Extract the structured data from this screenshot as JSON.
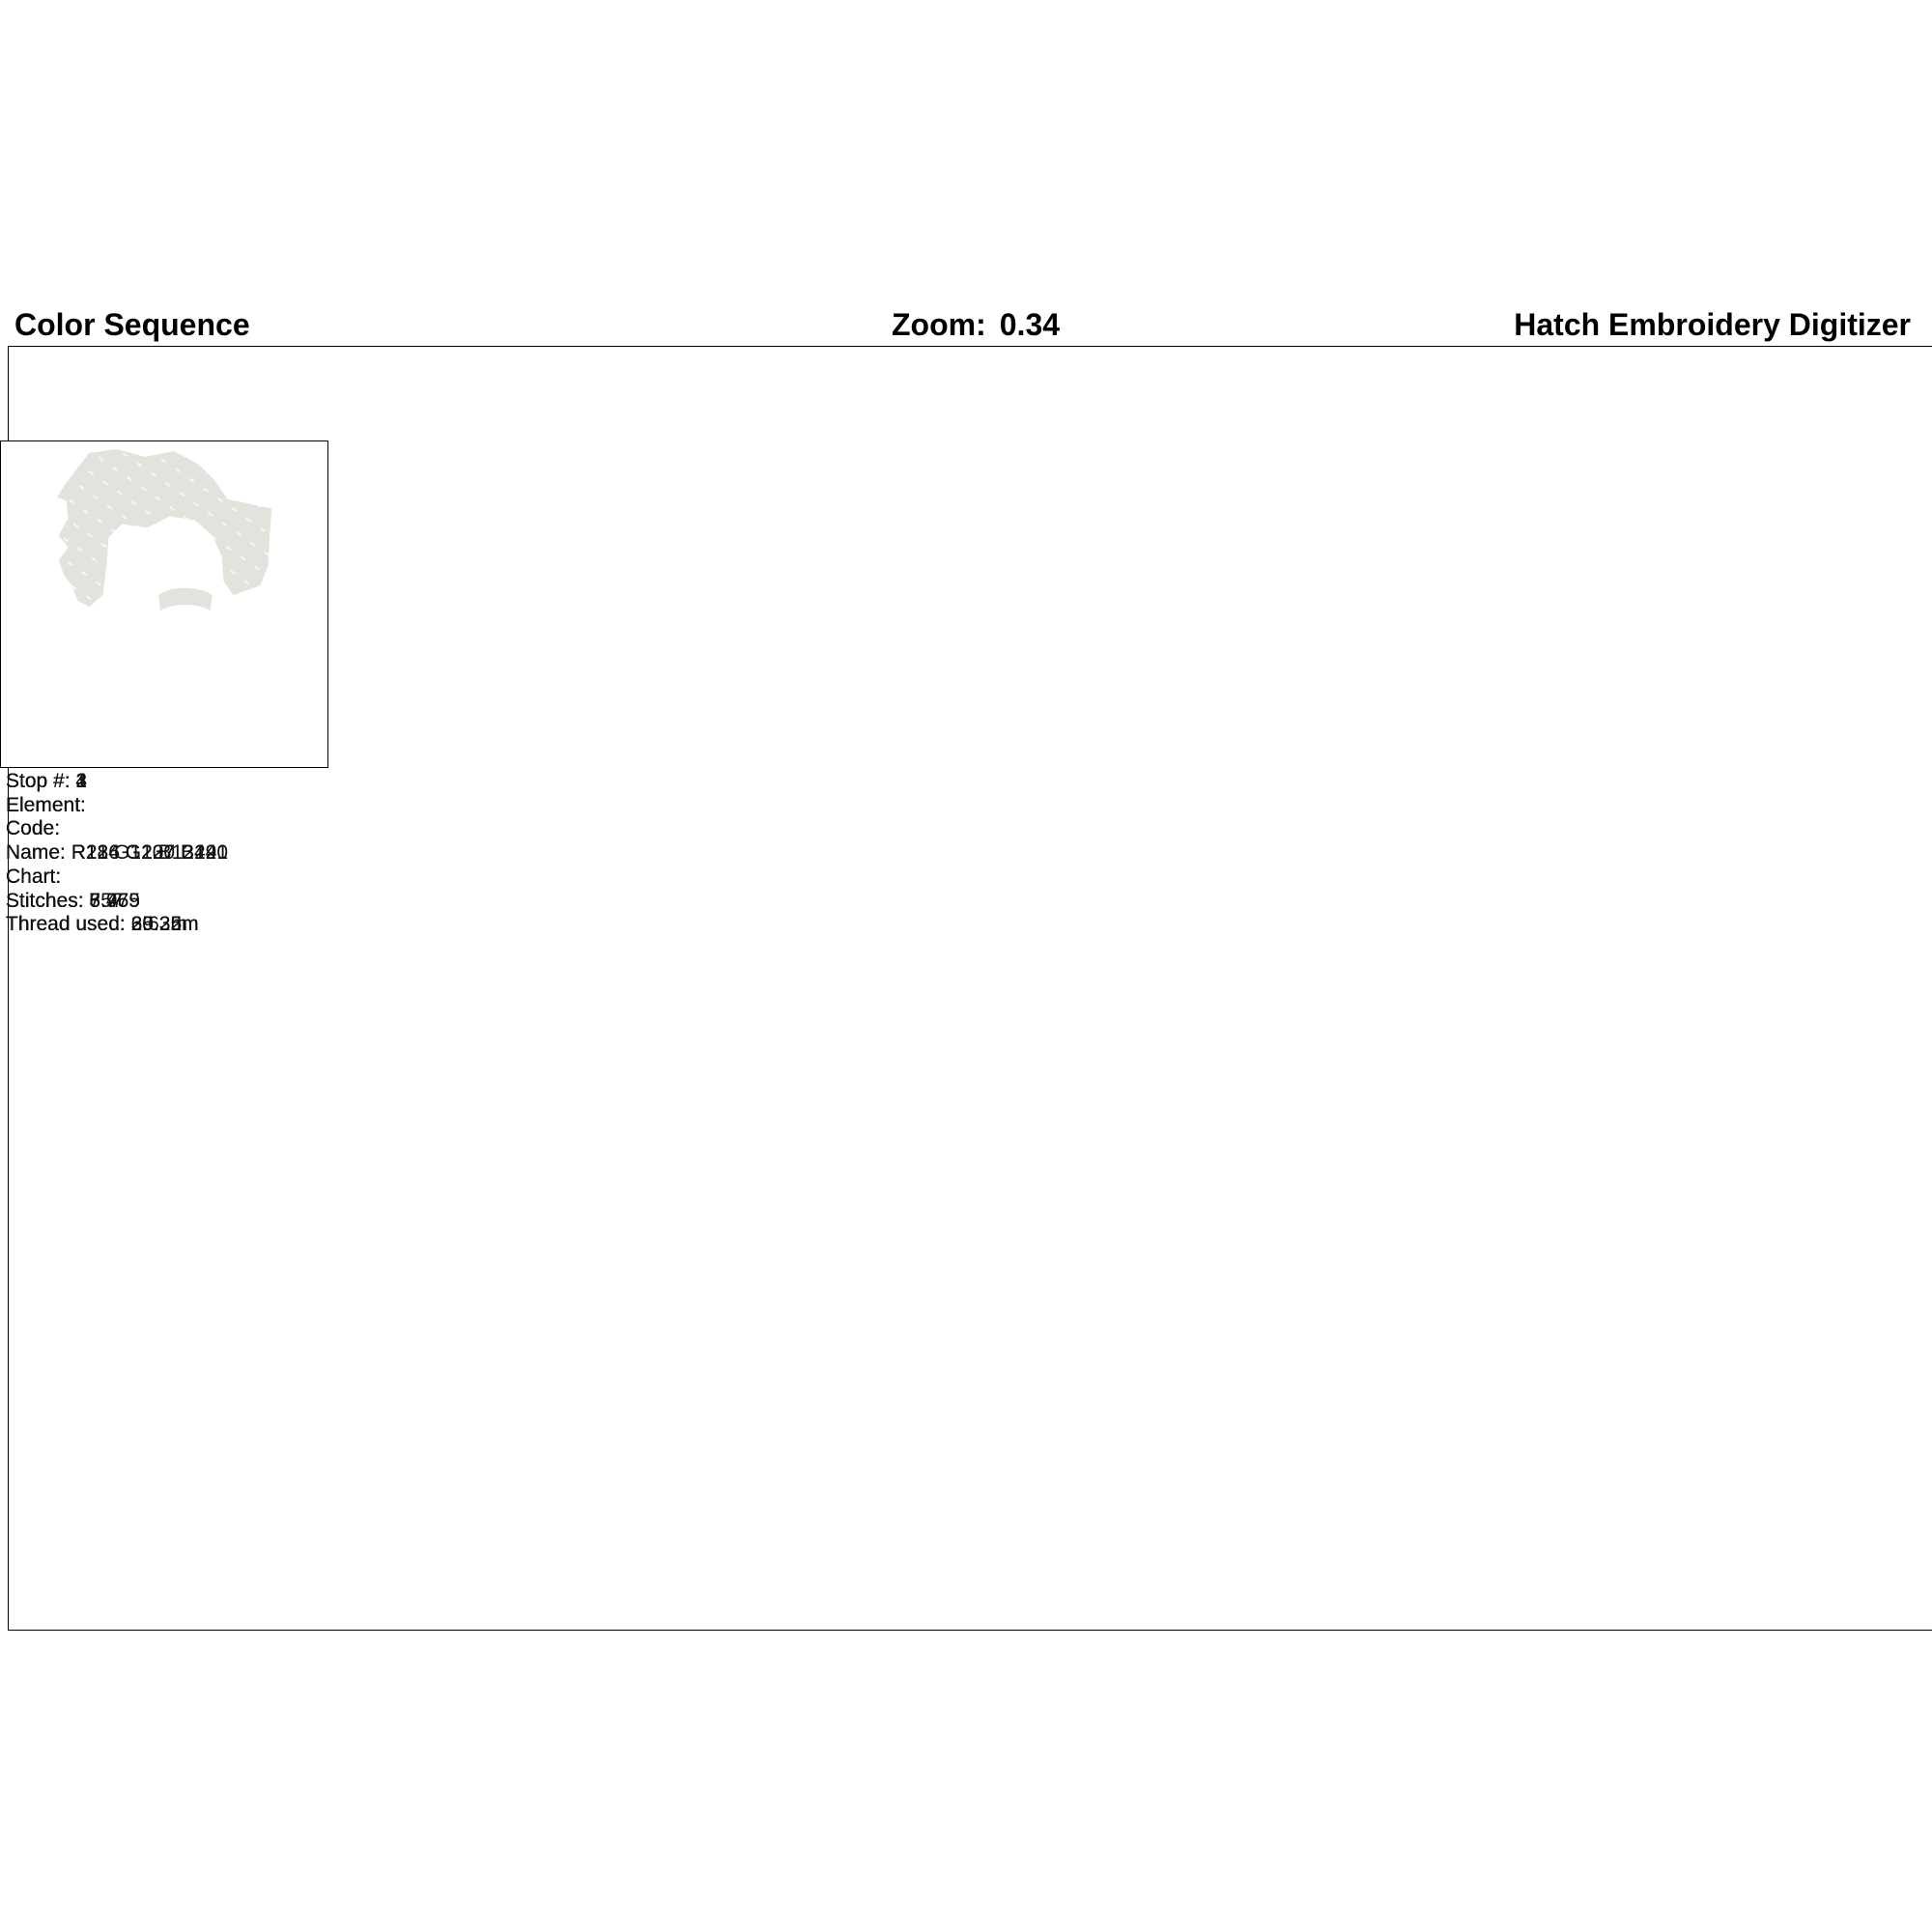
{
  "header": {
    "title": "Color Sequence",
    "zoom_label": "Zoom:",
    "zoom_value": "0.34",
    "software": "Hatch Embroidery Digitizer"
  },
  "labels": {
    "stop": "Stop #:",
    "element": "Element:",
    "code": "Code:",
    "name": "Name:",
    "chart": "Chart:",
    "stitches": "Stitches:",
    "thread": "Thread used:"
  },
  "stops": [
    {
      "number": "1",
      "element": "",
      "code": "",
      "name": "R184 G130 B44",
      "chart": "",
      "stitches": "8.769",
      "thread": "60.32m",
      "color": "#b8822c",
      "shape": "shirt"
    },
    {
      "number": "2",
      "element": "",
      "code": "",
      "name": "R13 G12 B12",
      "chart": "",
      "stitches": "757",
      "thread": "3.63m",
      "color": "#0d0c0c",
      "shape": "eyebrow-and-eye"
    },
    {
      "number": "3",
      "element": "",
      "code": "",
      "name": "R216 G207 B191",
      "chart": "",
      "stitches": "3.955",
      "thread": "25.35m",
      "color": "#d8cfbf",
      "shape": "face-skin"
    },
    {
      "number": "4",
      "element": "",
      "code": "",
      "name": "R226 G227 B220",
      "chart": "",
      "stitches": "6.475",
      "thread": "39.25m",
      "color": "#e2e3dc",
      "shape": "hair"
    }
  ]
}
